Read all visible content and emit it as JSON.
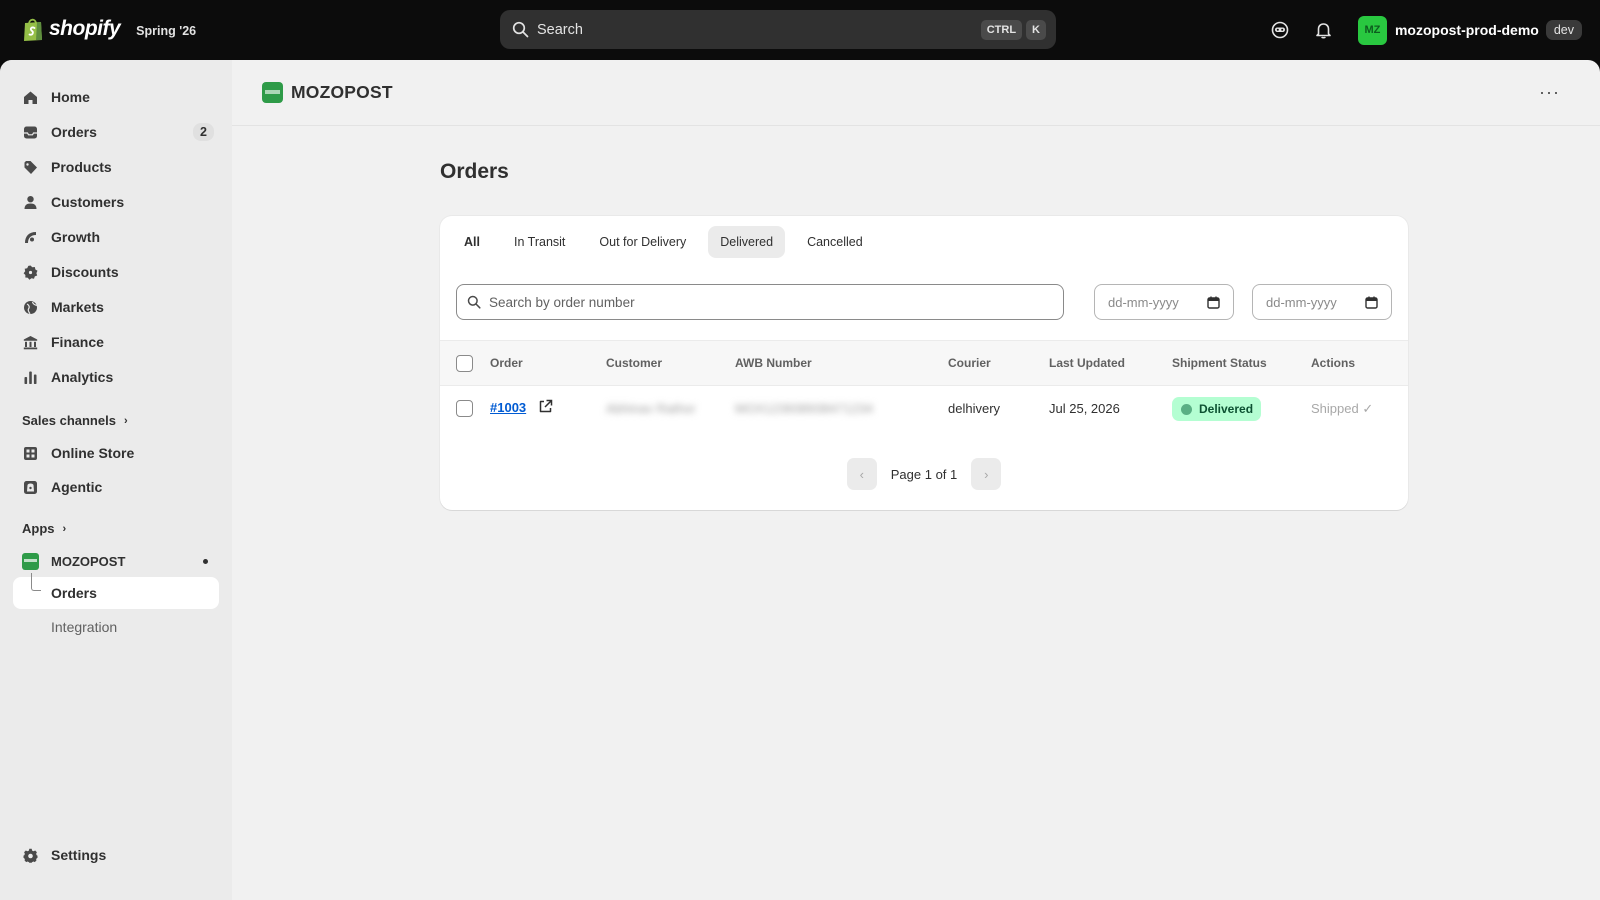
{
  "topbar": {
    "brand": "shopify",
    "season": "Spring '26",
    "search_label": "Search",
    "kbd1": "CTRL",
    "kbd2": "K",
    "avatar_initials": "MZ",
    "store_name": "mozopost-prod-demo",
    "store_badge": "dev",
    "icons": [
      "shopify-bag-icon",
      "search-icon",
      "sidekick-icon",
      "bell-icon"
    ]
  },
  "sidebar": {
    "items": [
      {
        "label": "Home",
        "icon": "home-icon"
      },
      {
        "label": "Orders",
        "icon": "orders-icon",
        "count": "2"
      },
      {
        "label": "Products",
        "icon": "tag-icon"
      },
      {
        "label": "Customers",
        "icon": "person-icon"
      },
      {
        "label": "Growth",
        "icon": "growth-icon"
      },
      {
        "label": "Discounts",
        "icon": "discount-icon"
      },
      {
        "label": "Markets",
        "icon": "globe-icon"
      },
      {
        "label": "Finance",
        "icon": "bank-icon"
      },
      {
        "label": "Analytics",
        "icon": "bar-chart-icon"
      }
    ],
    "sales_channels_label": "Sales channels",
    "channels": [
      {
        "label": "Online Store",
        "icon": "store-icon"
      },
      {
        "label": "Agentic",
        "icon": "agentic-icon"
      }
    ],
    "apps_label": "Apps",
    "app": {
      "label": "MOZOPOST"
    },
    "app_sub": [
      {
        "label": "Orders"
      },
      {
        "label": "Integration"
      }
    ],
    "settings_label": "Settings"
  },
  "app_header": {
    "title": "MOZOPOST",
    "more": "···"
  },
  "page": {
    "title": "Orders"
  },
  "tabs": [
    "All",
    "In Transit",
    "Out for Delivery",
    "Delivered",
    "Cancelled"
  ],
  "filters": {
    "search_placeholder": "Search by order number",
    "date_from": "dd-mm-yyyy",
    "date_to": "dd-mm-yyyy"
  },
  "table": {
    "columns": [
      "Order",
      "Customer",
      "AWB Number",
      "Courier",
      "Last Updated",
      "Shipment Status",
      "Actions"
    ],
    "rows": [
      {
        "order": "#1003",
        "customer": "Abhinav Rathor",
        "awb": "MOX123938938471234",
        "courier": "delhivery",
        "last_updated": "Jul 25, 2026",
        "status": "Delivered",
        "action": "Shipped ✓"
      }
    ]
  },
  "pagination": {
    "label": "Page 1 of 1",
    "prev": "‹",
    "next": "›"
  },
  "colors": {
    "topbar_bg": "#0c0c0c",
    "frame_bg": "#f1f1f1",
    "link": "#005bd3",
    "badge_bg": "#b4fed2",
    "avatar_bg": "#29c840",
    "app_logo": "#2e9b48"
  }
}
